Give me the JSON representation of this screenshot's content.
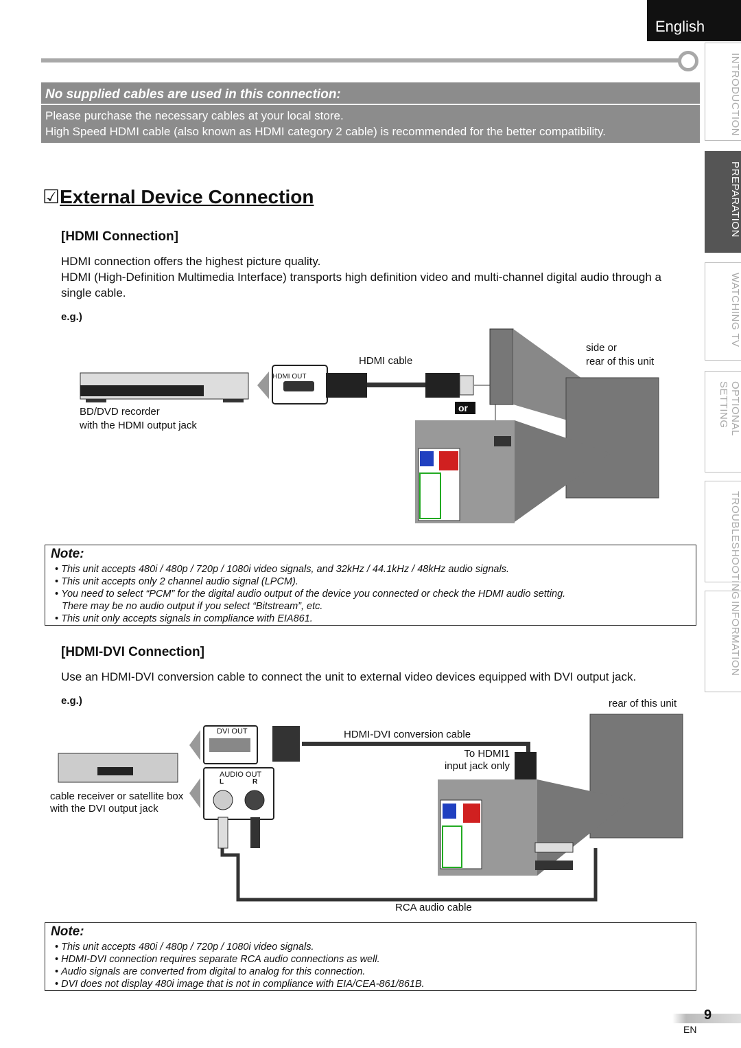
{
  "header": {
    "language": "English"
  },
  "side_tabs": [
    {
      "label": "INTRODUCTION",
      "active": false
    },
    {
      "label": "PREPARATION",
      "active": true
    },
    {
      "label": "WATCHING TV",
      "active": false
    },
    {
      "label": "OPTIONAL SETTING",
      "active": false
    },
    {
      "label": "TROUBLESHOOTING",
      "active": false
    },
    {
      "label": "INFORMATION",
      "active": false
    }
  ],
  "cables_box": {
    "heading": "No supplied cables are used in this connection:",
    "lines": [
      "Please purchase the necessary cables at your local store.",
      "High Speed HDMI cable (also known as HDMI category 2 cable) is recommended for the better compatibility."
    ]
  },
  "section": {
    "checkbox": "☑",
    "title": "External Device Connection"
  },
  "hdmi": {
    "heading": "[HDMI Connection]",
    "para1": "HDMI connection offers the highest picture quality.",
    "para2": "HDMI (High-Definition Multimedia Interface) transports high definition video and multi-channel digital audio through a single cable.",
    "eg": "e.g.)",
    "device_label": [
      "BD/DVD recorder",
      "with the HDMI output jack"
    ],
    "port_label": "HDMI OUT",
    "cable_label": "HDMI cable",
    "or": "or",
    "unit_label": [
      "side or",
      "rear of this unit"
    ],
    "note": {
      "heading": "Note:",
      "items": [
        "This unit accepts 480i / 480p / 720p / 1080i video signals, and 32kHz / 44.1kHz / 48kHz audio signals.",
        "This unit accepts only 2 channel audio signal (LPCM).",
        "You need to select “PCM” for the digital audio output of the device you connected or check the HDMI audio setting.",
        "There may be no audio output if you select “Bitstream”, etc.",
        "This unit only accepts signals in compliance with EIA861."
      ]
    }
  },
  "hdmi_dvi": {
    "heading": "[HDMI-DVI Connection]",
    "para": "Use an HDMI-DVI conversion cable to connect the unit to external video devices equipped with DVI output jack.",
    "eg": "e.g.)",
    "unit_label": "rear of this unit",
    "dvi_port": "DVI OUT",
    "audio_port": "AUDIO OUT",
    "audio_l": "L",
    "audio_r": "R",
    "cable_label": "HDMI-DVI conversion cable",
    "to_hdmi": [
      "To HDMI1",
      "input jack only"
    ],
    "device_label": [
      "cable receiver or satellite box",
      "with the DVI output jack"
    ],
    "rca_label": "RCA audio cable",
    "note": {
      "heading": "Note:",
      "items": [
        "This unit accepts 480i / 480p / 720p / 1080i video signals.",
        "HDMI-DVI connection requires separate RCA audio connections as well.",
        "Audio signals are converted from digital to analog for this connection.",
        "DVI does not display 480i image that is not in compliance with EIA/CEA-861/861B."
      ]
    }
  },
  "footer": {
    "page": "9",
    "lang": "EN"
  }
}
